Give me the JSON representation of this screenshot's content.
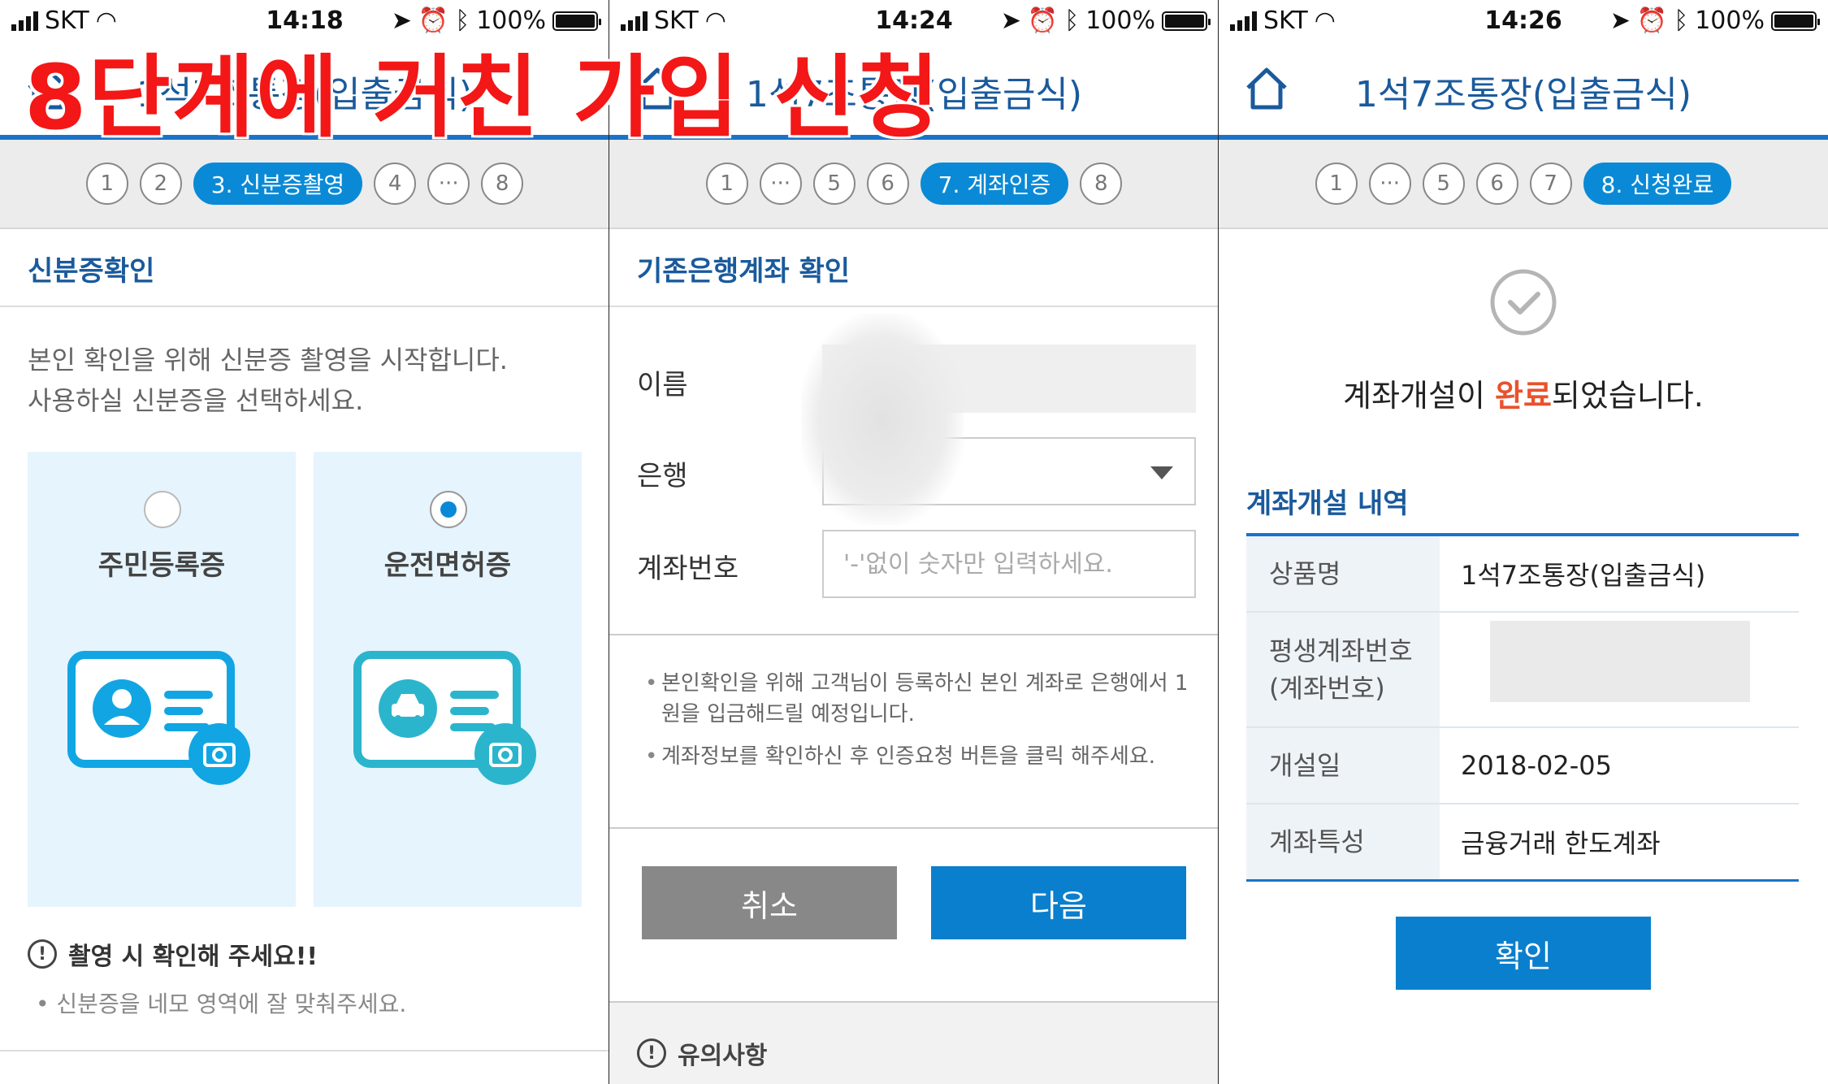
{
  "banner": "8단계에 거친 가입 신청",
  "colors": {
    "primary": "#0a8ad6",
    "accent_red": "#f31717",
    "highlight": "#e9522c"
  },
  "screens": [
    {
      "status": {
        "carrier": "SKT",
        "time": "14:18",
        "battery": "100%"
      },
      "title": "1석7조통장(입출금식)",
      "steps": [
        "1",
        "2",
        "3. 신분증촬영",
        "4",
        "···",
        "8"
      ],
      "active_step": 2,
      "section_title": "신분증확인",
      "desc_line1": "본인 확인을 위해 신분증 촬영을 시작합니다.",
      "desc_line2": "사용하실 신분증을 선택하세요.",
      "id_options": [
        {
          "label": "주민등록증",
          "selected": false,
          "icon": "id-card-person-icon"
        },
        {
          "label": "운전면허증",
          "selected": true,
          "icon": "id-card-car-icon"
        }
      ],
      "notice_title": "촬영 시 확인해 주세요!!",
      "notice_item": "신분증을 네모 영역에 잘 맞춰주세요."
    },
    {
      "status": {
        "carrier": "SKT",
        "time": "14:24",
        "battery": "100%"
      },
      "title": "1석7조통장(입출금식)",
      "steps": [
        "1",
        "···",
        "5",
        "6",
        "7. 계좌인증",
        "8"
      ],
      "active_step": 4,
      "section_title": "기존은행계좌 확인",
      "label_name": "이름",
      "label_bank": "은행",
      "label_account": "계좌번호",
      "account_placeholder": "'-'없이 숫자만 입력하세요.",
      "info": [
        "본인확인을 위해 고객님이 등록하신 본인 계좌로 은행에서 1원을 입금해드릴 예정입니다.",
        "계좌정보를 확인하신 후 인증요청 버튼을 클릭 해주세요."
      ],
      "cancel_label": "취소",
      "next_label": "다음",
      "caution_label": "유의사항"
    },
    {
      "status": {
        "carrier": "SKT",
        "time": "14:26",
        "battery": "100%"
      },
      "title": "1석7조통장(입출금식)",
      "steps": [
        "1",
        "···",
        "5",
        "6",
        "7",
        "8. 신청완료"
      ],
      "active_step": 5,
      "done_pre": "계좌개설이 ",
      "done_hl": "완료",
      "done_post": "되었습니다.",
      "section_title": "계좌개설 내역",
      "rows": [
        {
          "label": "상품명",
          "value": "1석7조통장(입출금식)"
        },
        {
          "label": "평생계좌번호\n(계좌번호)",
          "value": ""
        },
        {
          "label": "개설일",
          "value": "2018-02-05"
        },
        {
          "label": "계좌특성",
          "value": "금융거래 한도계좌"
        }
      ],
      "confirm_label": "확인"
    }
  ]
}
